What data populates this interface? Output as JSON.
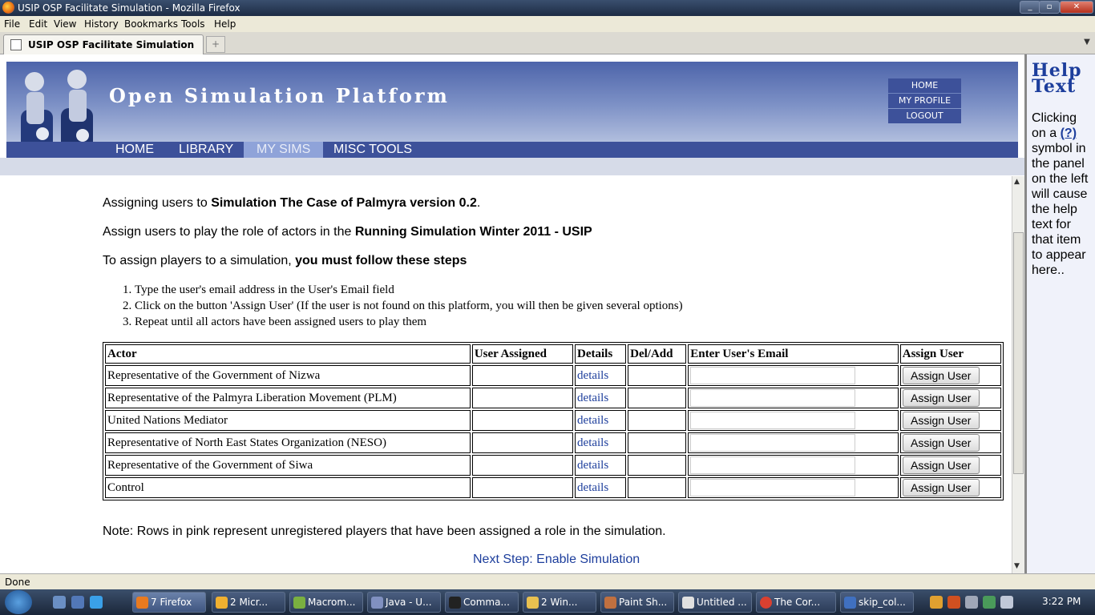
{
  "window": {
    "title": "USIP OSP Facilitate Simulation - Mozilla Firefox"
  },
  "menu": [
    "File",
    "Edit",
    "View",
    "History",
    "Bookmarks",
    "Tools",
    "Help"
  ],
  "tab": {
    "label": "USIP OSP Facilitate Simulation"
  },
  "site": {
    "title": "Open Simulation Platform",
    "topnav": [
      "HOME",
      "MY PROFILE",
      "LOGOUT"
    ],
    "mainnav": [
      "HOME",
      "LIBRARY",
      "MY SIMS",
      "MISC TOOLS"
    ],
    "active_nav": "MY SIMS"
  },
  "intro": {
    "line1_prefix": "Assigning users to ",
    "line1_bold": "Simulation The Case of Palmyra version 0.2",
    "line1_suffix": ".",
    "line2_prefix": "Assign users to play the role of actors in the ",
    "line2_bold": "Running Simulation Winter 2011 - USIP",
    "line3_prefix": "To assign players to a simulation, ",
    "line3_bold": "you must follow these steps"
  },
  "steps": [
    "Type the user's email address in the User's Email field",
    "Click on the button 'Assign User' (If the user is not found on this platform, you will then be given several options)",
    "Repeat until all actors have been assigned users to play them"
  ],
  "table": {
    "headers": [
      "Actor",
      "User Assigned",
      "Details",
      "Del/Add",
      "Enter User's Email",
      "Assign User"
    ],
    "rows": [
      {
        "actor": "Representative of the Government of Nizwa",
        "details": "details",
        "button": "Assign User"
      },
      {
        "actor": "Representative of the Palmyra Liberation Movement (PLM)",
        "details": "details",
        "button": "Assign User"
      },
      {
        "actor": "United Nations Mediator",
        "details": "details",
        "button": "Assign User"
      },
      {
        "actor": "Representative of North East States Organization (NESO)",
        "details": "details",
        "button": "Assign User"
      },
      {
        "actor": "Representative of the Government of Siwa",
        "details": "details",
        "button": "Assign User"
      },
      {
        "actor": "Control",
        "details": "details",
        "button": "Assign User"
      }
    ]
  },
  "note": "Note: Rows in pink represent unregistered players that have been assigned a role in the simulation.",
  "next_step": "Next Step: Enable Simulation",
  "help": {
    "title_line1": "Help",
    "title_line2": "Text",
    "body_prefix": "Clicking on a ",
    "body_link": "(?)",
    "body_suffix": " symbol in the panel on the left will cause the help text for that item to appear here.."
  },
  "status": "Done",
  "taskbar": {
    "buttons": [
      "7 Firefox",
      "2 Micr...",
      "Macrom...",
      "Java - U...",
      "Comma...",
      "2 Win...",
      "Paint Sh...",
      "Untitled ...",
      "The Cor...",
      "skip_col..."
    ],
    "clock": "3:22 PM"
  },
  "colors": {
    "nav": "#3d519a",
    "link": "#1d3e9c",
    "header_top": "#4d64aa"
  }
}
